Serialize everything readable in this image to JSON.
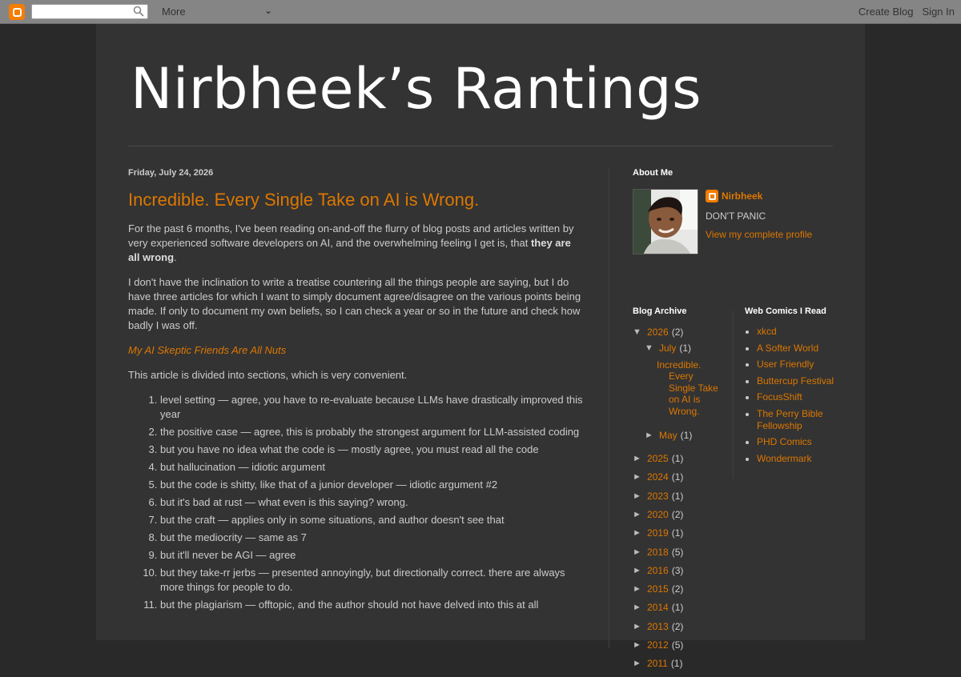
{
  "navbar": {
    "more_label": "More",
    "create_blog": "Create Blog",
    "sign_in": "Sign In",
    "search_placeholder": ""
  },
  "blog": {
    "title": "Nirbheek’s Rantings"
  },
  "post": {
    "date": "Friday, July 24, 2026",
    "title": "Incredible. Every Single Take on AI is Wrong.",
    "para1_start": "For the past 6 months, I've been reading on-and-off the flurry of blog posts and articles written by very experienced software developers on AI, and the overwhelming feeling I get is, that ",
    "para1_bold": "they are all wrong",
    "para1_end": ".",
    "para2": "I don't have the inclination to write a treatise countering all the things people are saying, but I do have three articles for which I want to simply document agree/disagree on the various points being made. If only to document my own beliefs, so I can check a year or so in the future and check how badly I was off.",
    "article_link": "My AI Skeptic Friends Are All Nuts",
    "para3": "This article is divided into sections, which is very convenient.",
    "list": [
      "level setting — agree, you have to re-evaluate because LLMs have drastically improved this year",
      "the positive case — agree, this is probably the strongest argument for LLM-assisted coding",
      "but you have no idea what the code is — mostly agree, you must read all the code",
      "but hallucination — idiotic argument",
      "but the code is shitty, like that of a junior developer — idiotic argument #2",
      "but it's bad at rust — what even is this saying? wrong.",
      "but the craft — applies only in some situations, and author doesn't see that",
      "but the mediocrity — same as 7",
      "but it'll never be AGI — agree",
      "but they take-rr jerbs — presented annoyingly, but directionally correct. there are always more things for people to do.",
      "but the plagiarism — offtopic, and the author should not have delved into this at all"
    ]
  },
  "about": {
    "title": "About Me",
    "name": "Nirbheek",
    "description": "DON'T PANIC",
    "profile_link": "View my complete profile"
  },
  "archive": {
    "title": "Blog Archive",
    "year_2026": {
      "label": "2026",
      "count": "(2)"
    },
    "july": {
      "label": "July",
      "count": "(1)"
    },
    "july_post": "Incredible. Every Single Take on AI is Wrong.",
    "may": {
      "label": "May",
      "count": "(1)"
    },
    "years": [
      {
        "label": "2025",
        "count": "(1)"
      },
      {
        "label": "2024",
        "count": "(1)"
      },
      {
        "label": "2023",
        "count": "(1)"
      },
      {
        "label": "2020",
        "count": "(2)"
      },
      {
        "label": "2019",
        "count": "(1)"
      },
      {
        "label": "2018",
        "count": "(5)"
      },
      {
        "label": "2016",
        "count": "(3)"
      },
      {
        "label": "2015",
        "count": "(2)"
      },
      {
        "label": "2014",
        "count": "(1)"
      },
      {
        "label": "2013",
        "count": "(2)"
      },
      {
        "label": "2012",
        "count": "(5)"
      },
      {
        "label": "2011",
        "count": "(1)"
      }
    ],
    "expanded_glyph": "▼",
    "collapsed_glyph": "►"
  },
  "comics": {
    "title": "Web Comics I Read",
    "items": [
      "xkcd",
      "A Softer World",
      "User Friendly",
      "Buttercup Festival",
      "FocusShift",
      "The Perry Bible Fellowship",
      "PHD Comics",
      "Wondermark"
    ]
  },
  "colors": {
    "accent": "#dd7700",
    "background": "#292929",
    "panel": "#333333",
    "navbar": "#858585"
  }
}
